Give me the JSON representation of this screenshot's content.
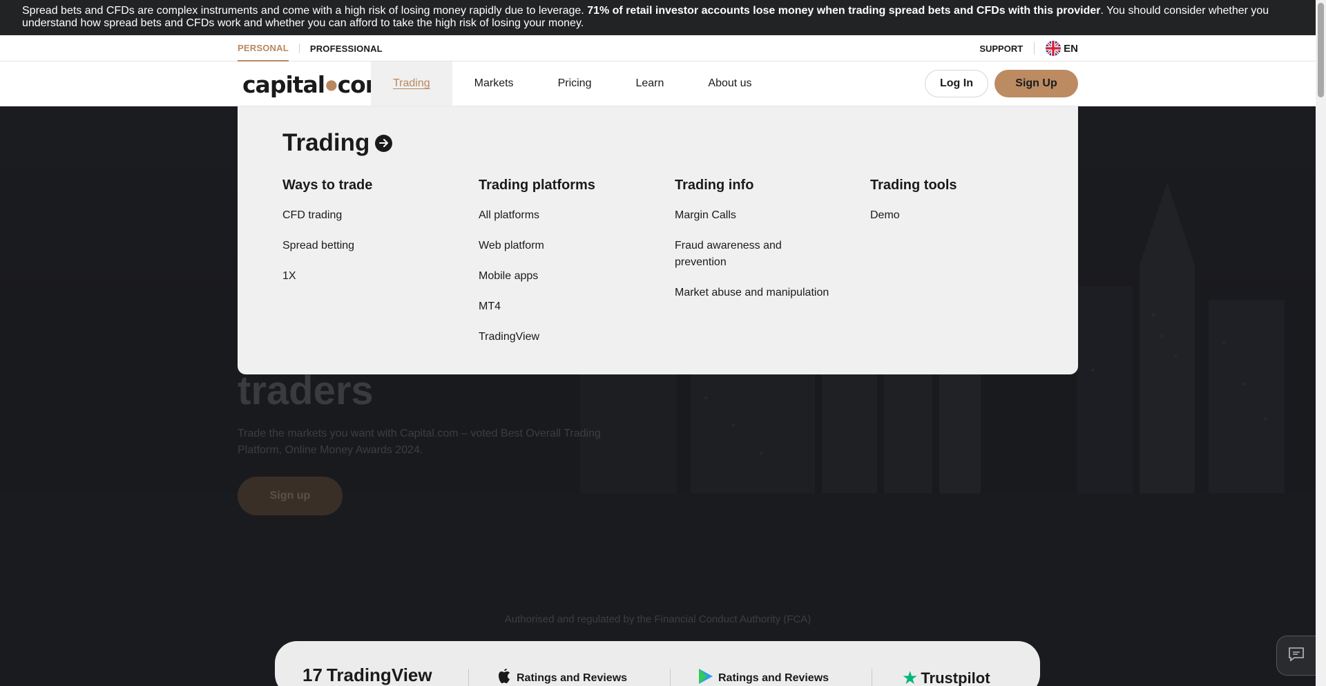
{
  "risk_banner": {
    "text_before": "Spread bets and CFDs are complex instruments and come with a high risk of losing money rapidly due to leverage. ",
    "text_bold": "71% of retail investor accounts lose money when trading spread bets and CFDs with this provider",
    "text_after": ". You should consider whether you understand how spread bets and CFDs work and whether you can afford to take the high risk of losing your money."
  },
  "utility_bar": {
    "personal": "PERSONAL",
    "professional": "PROFESSIONAL",
    "support": "SUPPORT",
    "language": "EN"
  },
  "nav": {
    "logo_left": "capital",
    "logo_right": "com",
    "items": [
      {
        "label": "Trading",
        "active": true
      },
      {
        "label": "Markets"
      },
      {
        "label": "Pricing"
      },
      {
        "label": "Learn"
      },
      {
        "label": "About us"
      }
    ],
    "login": "Log In",
    "signup": "Sign Up"
  },
  "mega_menu": {
    "title": "Trading",
    "columns": [
      {
        "heading": "Ways to trade",
        "links": [
          "CFD trading",
          "Spread betting",
          "1X"
        ]
      },
      {
        "heading": "Trading platforms",
        "links": [
          "All platforms",
          "Web platform",
          "Mobile apps",
          "MT4",
          "TradingView"
        ]
      },
      {
        "heading": "Trading info",
        "links": [
          "Margin Calls",
          "Fraud awareness and prevention",
          "Market abuse and manipulation"
        ]
      },
      {
        "heading": "Trading tools",
        "links": [
          "Demo"
        ]
      }
    ]
  },
  "hero": {
    "title_visible": "traders",
    "subtitle": "Trade the markets you want with Capital.com – voted Best Overall Trading Platform, Online Money Awards 2024.",
    "cta": "Sign up",
    "regulation": "Authorised and regulated by the Financial Conduct Authority (FCA)"
  },
  "ratings": {
    "tradingview": "TradingView",
    "apple": "Ratings and Reviews",
    "google": "Ratings and Reviews",
    "trustpilot": "Trustpilot"
  },
  "colors": {
    "accent": "#b9875d",
    "banner_bg": "#222324",
    "menu_bg": "#f0f0f0"
  }
}
